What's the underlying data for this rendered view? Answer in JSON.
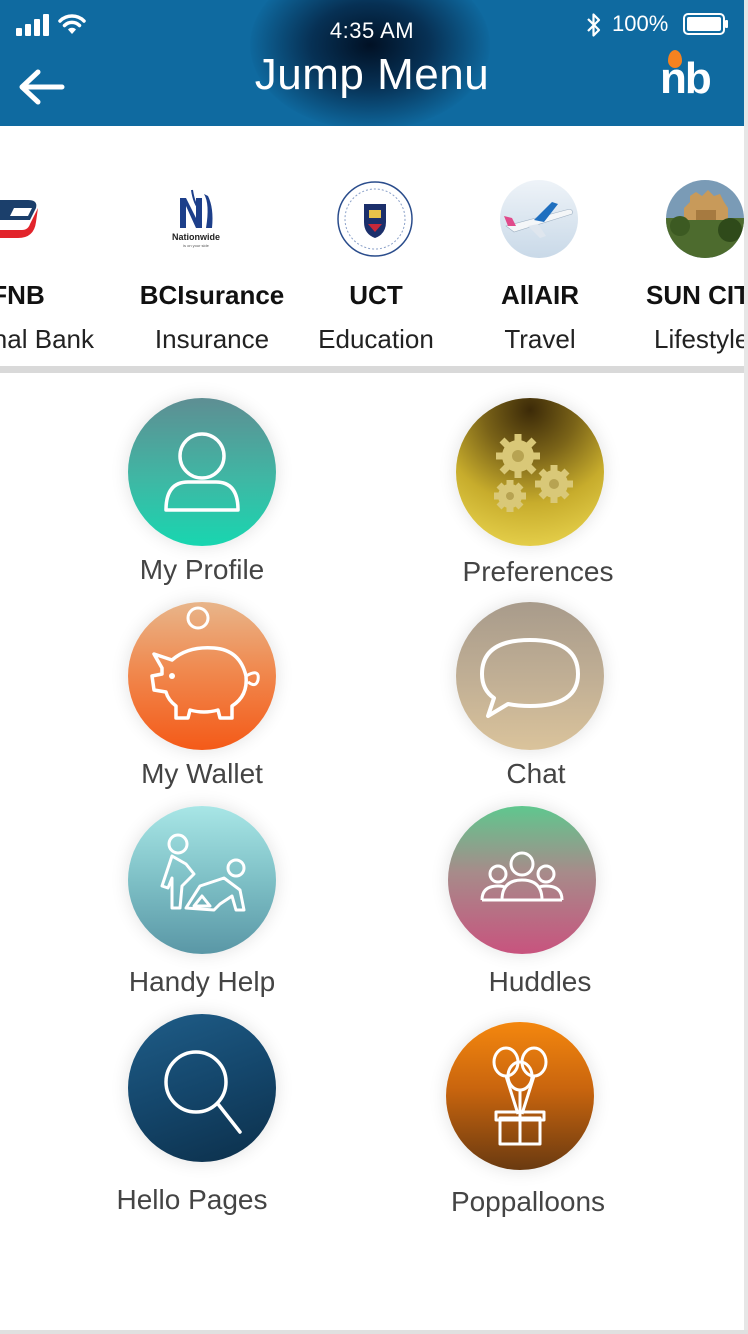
{
  "status_bar": {
    "time": "4:35 AM",
    "battery_percent": "100%",
    "battery_level": 1.0,
    "icons": [
      "signal-icon",
      "wifi-icon",
      "bluetooth-icon",
      "battery-icon"
    ]
  },
  "header": {
    "title": "Jump Menu",
    "back_icon": "back-arrow-icon",
    "brand_logo_text": "nb",
    "colors": {
      "background": "#0f6aa0",
      "brand_accent": "#f5821f"
    }
  },
  "partners": [
    {
      "name": "FNB",
      "category": "onal Bank",
      "logo": "fnb-logo"
    },
    {
      "name": "BCIsurance",
      "category": "Insurance",
      "logo": "nationwide-logo",
      "logo_text": "Nationwide"
    },
    {
      "name": "UCT",
      "category": "Education",
      "logo": "uct-crest-logo"
    },
    {
      "name": "AllAIR",
      "category": "Travel",
      "logo": "airplane-photo"
    },
    {
      "name": "SUN CIT",
      "category": "Lifestyle",
      "logo": "sun-city-photo"
    }
  ],
  "menu": {
    "items": [
      {
        "label": "My Profile",
        "icon": "user-icon"
      },
      {
        "label": "Preferences",
        "icon": "gears-icon"
      },
      {
        "label": "My Wallet",
        "icon": "piggy-bank-icon"
      },
      {
        "label": "Chat",
        "icon": "speech-bubble-icon"
      },
      {
        "label": "Handy Help",
        "icon": "helping-people-icon"
      },
      {
        "label": "Huddles",
        "icon": "group-icon"
      },
      {
        "label": "Hello Pages",
        "icon": "search-icon"
      },
      {
        "label": "Poppalloons",
        "icon": "balloons-gift-icon"
      }
    ]
  }
}
